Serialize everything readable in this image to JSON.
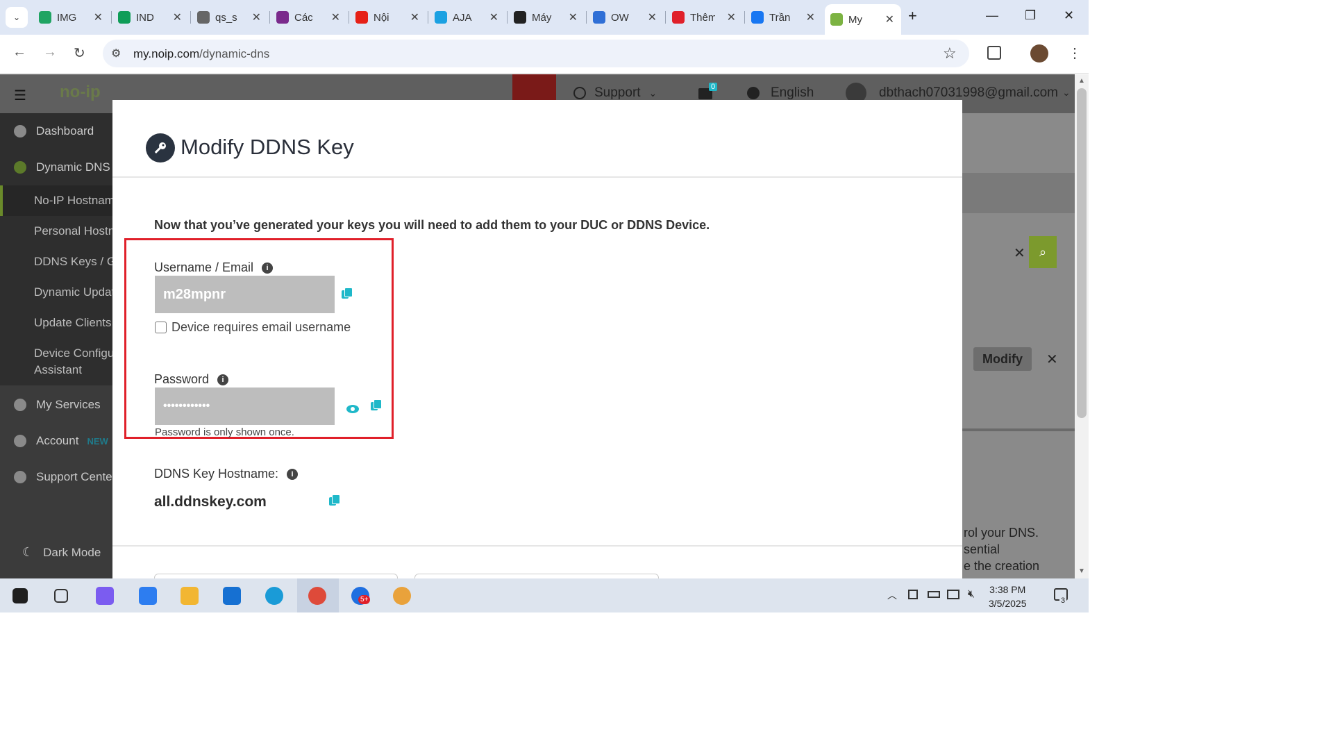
{
  "browser": {
    "tabs": [
      {
        "label": "IMG",
        "icon": "google-drive-icon",
        "color": "#1fa463"
      },
      {
        "label": "IND",
        "icon": "sheets-icon",
        "color": "#0f9d58"
      },
      {
        "label": "qs_s",
        "icon": "globe-icon",
        "color": "#666666"
      },
      {
        "label": "Các",
        "icon": "tab-app-icon",
        "color": "#7a2a8c"
      },
      {
        "label": "Nội",
        "icon": "youtube-icon",
        "color": "#e62117"
      },
      {
        "label": "AJA",
        "icon": "aja-icon",
        "color": "#1ba1e2"
      },
      {
        "label": "Máy",
        "icon": "chatgpt-icon",
        "color": "#222222"
      },
      {
        "label": "OW",
        "icon": "ow-icon",
        "color": "#2f6fd6"
      },
      {
        "label": "Thêm",
        "icon": "indata-icon",
        "color": "#e0202a"
      },
      {
        "label": "Trần",
        "icon": "facebook-icon",
        "color": "#1877f2"
      },
      {
        "label": "My",
        "icon": "noip-icon",
        "color": "#7cb342"
      }
    ],
    "url_domain": "my.noip.com",
    "url_path": "/dynamic-dns"
  },
  "sitebar": {
    "support": "Support",
    "cart_count": "0",
    "language": "English",
    "account_email": "dbthach07031998@gmail.com"
  },
  "sidebar": {
    "items": [
      {
        "label": "Dashboard"
      },
      {
        "label": "Dynamic DNS"
      },
      {
        "label": "My Services"
      },
      {
        "label": "Account"
      },
      {
        "label": "Support Center"
      },
      {
        "label": "Dark Mode"
      }
    ],
    "sub_items": [
      "No-IP Hostnames",
      "Personal Hostnames",
      "DDNS Keys / Groups",
      "Dynamic Update",
      "Update Clients",
      "Device Configuration",
      "Assistant"
    ],
    "account_badge": "NEW"
  },
  "modal": {
    "title": "Modify DDNS Key",
    "intro": "Now that you’ve generated your keys you will need to add them to your DUC or DDNS Device.",
    "username_label": "Username / Email",
    "username_value": "m28mpnr",
    "checkbox_label": "Device requires email username",
    "password_label": "Password",
    "password_value": "••••••••••••",
    "password_note": "Password is only shown once.",
    "hostname_label": "DDNS Key Hostname:",
    "hostname_value": "all.ddnskey.com"
  },
  "background": {
    "modify_button": "Modify",
    "dns_text_1": "rol your DNS.",
    "dns_text_2": "sential",
    "dns_text_3": "e the creation"
  },
  "taskbar": {
    "time": "3:38 PM",
    "date": "3/5/2025",
    "notification_count": "3",
    "zalo_badge": "5+"
  }
}
